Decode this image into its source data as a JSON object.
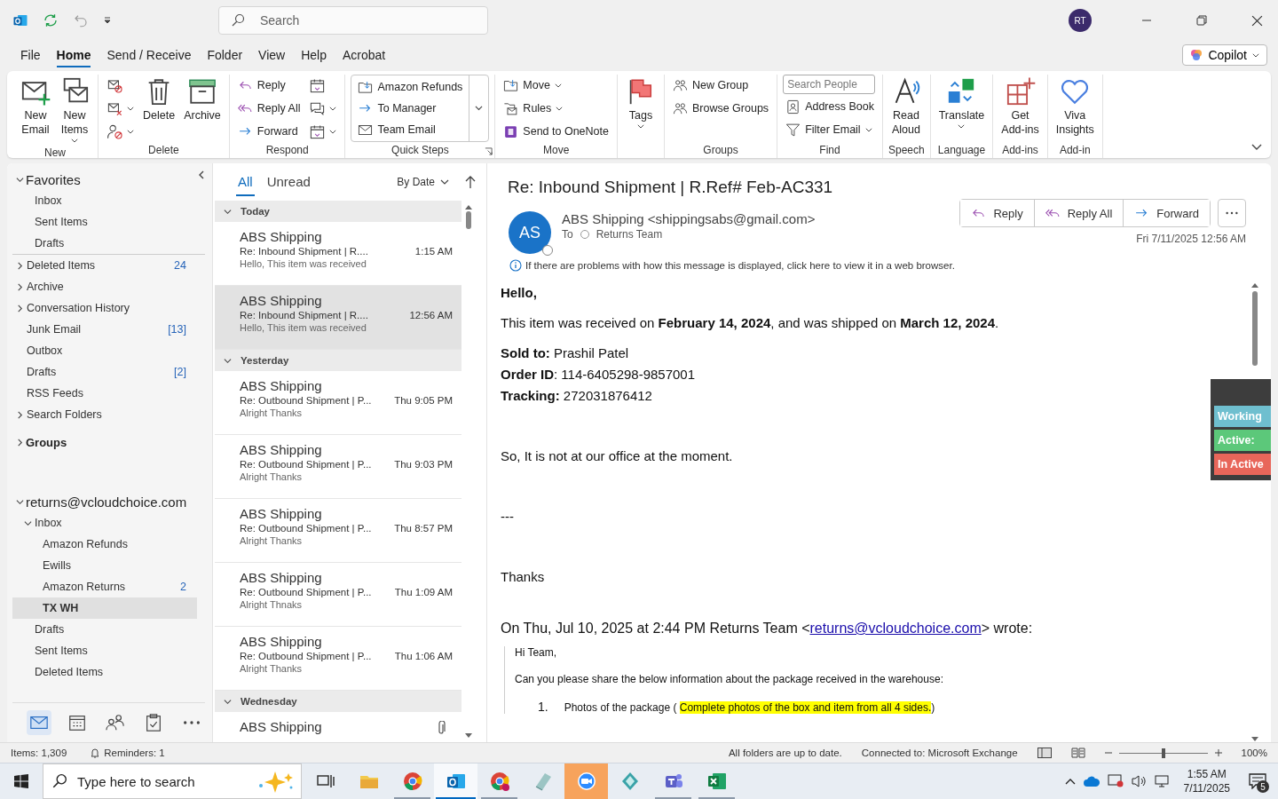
{
  "title_bar": {
    "search_placeholder": "Search",
    "avatar": "RT"
  },
  "menu_tabs": [
    {
      "label": "File",
      "selected": false
    },
    {
      "label": "Home",
      "selected": true
    },
    {
      "label": "Send / Receive",
      "selected": false
    },
    {
      "label": "Folder",
      "selected": false
    },
    {
      "label": "View",
      "selected": false
    },
    {
      "label": "Help",
      "selected": false
    },
    {
      "label": "Acrobat",
      "selected": false
    }
  ],
  "copilot": "Copilot",
  "ribbon": [
    {
      "label": "New",
      "columns": [
        {
          "items": [
            {
              "kind": "large",
              "label": "New Email",
              "dropdown": false
            }
          ]
        },
        {
          "items": [
            {
              "kind": "large",
              "label": "New Items",
              "dropdown": true
            }
          ]
        }
      ]
    },
    {
      "label": "Delete",
      "columns": [
        {
          "items": [
            {
              "kind": "icon",
              "dropdown": false
            },
            {
              "kind": "icon",
              "dropdown": true
            },
            {
              "kind": "icon",
              "dropdown": true
            }
          ]
        },
        {
          "items": [
            {
              "kind": "large",
              "label": "Delete",
              "dropdown": false
            }
          ]
        },
        {
          "items": [
            {
              "kind": "large",
              "label": "Archive",
              "dropdown": false
            }
          ]
        }
      ]
    },
    {
      "label": "Respond",
      "columns": [
        {
          "items": [
            {
              "kind": "small",
              "label": "Reply",
              "dropdown": false
            },
            {
              "kind": "small",
              "label": "Reply All",
              "dropdown": false
            },
            {
              "kind": "small",
              "label": "Forward",
              "dropdown": false
            }
          ]
        },
        {
          "items": [
            {
              "kind": "icon",
              "dropdown": false
            },
            {
              "kind": "icon",
              "dropdown": true
            },
            {
              "kind": "icon",
              "dropdown": true
            }
          ]
        }
      ]
    },
    {
      "label": "Quick Steps",
      "launcher": true,
      "columns": [
        {
          "items": [
            {
              "kind": "quickstep",
              "label": "Amazon Refunds",
              "dropdown": false
            },
            {
              "kind": "quickstep",
              "label": "To Manager",
              "dropdown": false
            },
            {
              "kind": "quickstep",
              "label": "Team Email",
              "dropdown": false
            }
          ]
        }
      ]
    },
    {
      "label": "Move",
      "columns": [
        {
          "items": [
            {
              "kind": "small",
              "label": "Move",
              "dropdown": true
            },
            {
              "kind": "small",
              "label": "Rules",
              "dropdown": true
            },
            {
              "kind": "small",
              "label": "Send to OneNote",
              "dropdown": false
            }
          ]
        }
      ]
    },
    {
      "columns": [
        {
          "items": [
            {
              "kind": "large",
              "label": "Tags",
              "dropdown": true
            }
          ]
        }
      ]
    },
    {
      "label": "Groups",
      "columns": [
        {
          "items": [
            {
              "kind": "small",
              "label": "New Group",
              "dropdown": false
            },
            {
              "kind": "small",
              "label": "Browse Groups",
              "dropdown": false
            }
          ]
        }
      ]
    },
    {
      "label": "Find",
      "columns": [
        {
          "items": [
            {
              "kind": "search",
              "placeholder": "Search People"
            },
            {
              "kind": "small",
              "label": "Address Book",
              "dropdown": false
            },
            {
              "kind": "small",
              "label": "Filter Email",
              "dropdown": true
            }
          ]
        }
      ]
    },
    {
      "label": "Speech",
      "columns": [
        {
          "items": [
            {
              "kind": "large",
              "label": "Read Aloud",
              "dropdown": false
            }
          ]
        }
      ]
    },
    {
      "label": "Language",
      "columns": [
        {
          "items": [
            {
              "kind": "large",
              "label": "Translate",
              "dropdown": true
            }
          ]
        }
      ]
    },
    {
      "label": "Add-ins",
      "columns": [
        {
          "items": [
            {
              "kind": "large",
              "label": "Get Add-ins",
              "dropdown": false
            }
          ]
        }
      ]
    },
    {
      "label": "Add-in",
      "columns": [
        {
          "items": [
            {
              "kind": "large",
              "label": "Viva Insights",
              "dropdown": false
            }
          ]
        }
      ]
    }
  ],
  "folder_pane": {
    "sections": [
      {
        "label": "Favorites",
        "expanded": true,
        "items": [
          {
            "label": "Inbox",
            "kind": "leaf",
            "selected": false
          },
          {
            "label": "Sent Items",
            "kind": "leaf",
            "selected": false
          },
          {
            "label": "Drafts",
            "kind": "leaf",
            "selected": false
          }
        ]
      },
      {
        "items": [
          {
            "label": "Deleted Items",
            "kind": "parent",
            "expanded": false,
            "count": "24",
            "selected": false
          },
          {
            "label": "Archive",
            "kind": "parent",
            "expanded": false,
            "selected": false
          },
          {
            "label": "Conversation History",
            "kind": "parent",
            "expanded": false,
            "selected": false
          },
          {
            "label": "Junk Email",
            "kind": "leaf",
            "count": "[13]",
            "selected": false
          },
          {
            "label": "Outbox",
            "kind": "leaf",
            "selected": false
          },
          {
            "label": "Drafts",
            "kind": "leaf",
            "count": "[2]",
            "selected": false
          },
          {
            "label": "RSS Feeds",
            "kind": "leaf",
            "selected": false
          },
          {
            "label": "Search Folders",
            "kind": "parent",
            "expanded": false,
            "selected": false
          }
        ]
      },
      {
        "label": "Groups",
        "expanded": false
      },
      {
        "label": "returns@vcloudchoice.com",
        "expanded": true,
        "items": [
          {
            "label": "Inbox",
            "kind": "parent",
            "expanded": true,
            "selected": false,
            "children": [
              {
                "label": "Amazon Refunds",
                "kind": "leaf",
                "selected": false
              },
              {
                "label": "Ewills",
                "kind": "leaf",
                "selected": false
              },
              {
                "label": "Amazon Returns",
                "kind": "leaf",
                "count": "2",
                "selected": false
              },
              {
                "label": "TX WH",
                "kind": "leaf",
                "selected": true
              }
            ]
          },
          {
            "label": "Drafts",
            "kind": "leaf",
            "selected": false
          },
          {
            "label": "Sent Items",
            "kind": "leaf",
            "selected": false
          },
          {
            "label": "Deleted Items",
            "kind": "leaf",
            "selected": false
          }
        ]
      }
    ]
  },
  "nav_icons": [
    {
      "selected": true
    },
    {
      "selected": false
    },
    {
      "selected": false
    },
    {
      "selected": false
    },
    {
      "selected": false
    }
  ],
  "message_list": {
    "filters": [
      {
        "label": "All",
        "selected": true
      },
      {
        "label": "Unread",
        "selected": false
      }
    ],
    "sort": "By Date",
    "groups": [
      {
        "label": "Today",
        "messages": [
          {
            "sender": "ABS Shipping",
            "subject": "Re: Inbound Shipment | R....",
            "time": "1:15 AM",
            "preview": "Hello,  This item was received",
            "selected": false,
            "attachment": false
          },
          {
            "sender": "ABS Shipping",
            "subject": "Re: Inbound Shipment | R....",
            "time": "12:56 AM",
            "preview": "Hello,  This item was received",
            "selected": true,
            "attachment": false
          }
        ]
      },
      {
        "label": "Yesterday",
        "messages": [
          {
            "sender": "ABS Shipping",
            "subject": "Re: Outbound Shipment | P...",
            "time": "Thu 9:05 PM",
            "preview": "Alright  Thanks",
            "selected": false,
            "attachment": false
          },
          {
            "sender": "ABS Shipping",
            "subject": "Re: Outbound Shipment | P...",
            "time": "Thu 9:03 PM",
            "preview": "Alright  Thanks",
            "selected": false,
            "attachment": false
          },
          {
            "sender": "ABS Shipping",
            "subject": "Re: Outbound Shipment | P...",
            "time": "Thu 8:57 PM",
            "preview": "Alright  Thanks",
            "selected": false,
            "attachment": false
          },
          {
            "sender": "ABS Shipping",
            "subject": "Re: Outbound Shipment | P...",
            "time": "Thu 1:09 AM",
            "preview": "Alright  Thnaks",
            "selected": false,
            "attachment": false
          },
          {
            "sender": "ABS Shipping",
            "subject": "Re: Outbound Shipment | P...",
            "time": "Thu 1:06 AM",
            "preview": "Alright  Thanks",
            "selected": false,
            "attachment": false
          }
        ]
      },
      {
        "label": "Wednesday",
        "messages": [
          {
            "sender": "ABS Shipping",
            "selected": false,
            "attachment": true
          }
        ]
      }
    ]
  },
  "reading_pane": {
    "subject": "Re: Inbound Shipment | R.Ref# Feb-AC331",
    "avatar": "AS",
    "from": "ABS Shipping <shippingsabs@gmail.com>",
    "to_label": "To",
    "to": "Returns Team",
    "actions": [
      "Reply",
      "Reply All",
      "Forward"
    ],
    "date": "Fri 7/11/2025 12:56 AM",
    "info": "If there are problems with how this message is displayed, click here to view it in a web browser.",
    "body": [
      {
        "kind": "bold",
        "text": "Hello,"
      },
      {
        "kind": "para",
        "text": "This item was received on **February 14, 2024**, and was shipped on **March 12, 2024**."
      },
      {
        "kind": "field",
        "text": "**Sold to:** Prashil Patel"
      },
      {
        "kind": "field",
        "text": "**Order ID**: 114-6405298-9857001"
      },
      {
        "kind": "field",
        "text": "**Tracking:** 272031876412"
      },
      {
        "kind": "far",
        "text": "So, It is not at our office at the moment."
      },
      {
        "kind": "far",
        "text": "---"
      },
      {
        "kind": "far",
        "text": "Thanks"
      }
    ],
    "quote_header": {
      "before": "On Thu, Jul 10, 2025 at 2:44 PM Returns Team <",
      "link": "returns@vcloudchoice.com",
      "after": "> wrote:"
    },
    "quote": {
      "greeting": "Hi Team,",
      "request": "Can you please share the below information about the package received in the warehouse:",
      "list": [
        {
          "number": "1.",
          "text": "Photos of the package ( ",
          "highlight": "Complete photos of the box and item from all 4 sides.",
          "after": ")"
        }
      ]
    }
  },
  "status_widget": [
    {
      "label": "Working",
      "color": "#6fbfcf"
    },
    {
      "label": "Active:",
      "color": "#5cc87a"
    },
    {
      "label": "In Active",
      "color": "#e8665a"
    }
  ],
  "status_bar": {
    "items": "Items: 1,309",
    "reminders": "Reminders: 1",
    "sync": "All folders are up to date.",
    "connection": "Connected to: Microsoft Exchange",
    "zoom": {
      "level": 0.5
    },
    "zoom_reading": "100%"
  },
  "taskbar": {
    "search_placeholder": "Type here to search",
    "apps": [
      {
        "running": false,
        "selected": false
      },
      {
        "running": false,
        "selected": false
      },
      {
        "running": true,
        "selected": false
      },
      {
        "running": true,
        "selected": true
      },
      {
        "running": true,
        "selected": false
      },
      {
        "running": false,
        "selected": false
      },
      {
        "running": false,
        "selected": false
      },
      {
        "running": false,
        "selected": false
      },
      {
        "running": true,
        "selected": false
      },
      {
        "running": true,
        "selected": false
      }
    ],
    "time": "1:55 AM",
    "date": "7/11/2025",
    "notifications": "5"
  }
}
